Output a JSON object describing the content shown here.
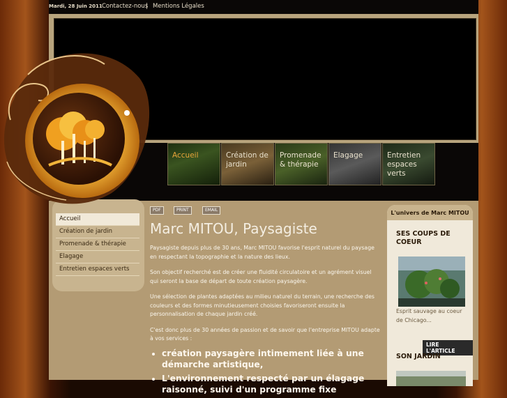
{
  "topbar": {
    "date": "Mardi, 28 Juin 2011",
    "contact": "Contactez-nous",
    "separator": "|",
    "legal": "Mentions Légales"
  },
  "nav": {
    "tabs": [
      {
        "label": "Accueil",
        "active": true
      },
      {
        "label": "Création de jardin",
        "active": false
      },
      {
        "label": "Promenade & thérapie",
        "active": false
      },
      {
        "label": "Elagage",
        "active": false
      },
      {
        "label": "Entretien espaces verts",
        "active": false
      }
    ]
  },
  "left_menu": {
    "items": [
      {
        "label": "Accueil",
        "active": true
      },
      {
        "label": "Création de jardin",
        "active": false
      },
      {
        "label": "Promenade & thérapie",
        "active": false
      },
      {
        "label": "Elagage",
        "active": false
      },
      {
        "label": "Entretien espaces verts",
        "active": false
      }
    ]
  },
  "tools": {
    "pdf": "PDF",
    "print": "PRINT",
    "email": "EMAIL"
  },
  "article": {
    "title": "Marc MITOU, Paysagiste",
    "paragraphs": [
      "Paysagiste depuis plus de 30 ans, Marc MITOU favorise l'esprit naturel du paysage en respectant la topographie et la nature des lieux.",
      "Son objectif recherché est de créer une fluidité circulatoire et un agrément visuel qui seront la base de départ de toute création paysagère.",
      "Une sélection de plantes adaptées au milieu naturel du terrain, une recherche des couleurs et des formes minutieusement choisies favoriseront ensuite la personnalisation de chaque jardin créé.",
      "C'est donc plus de 30 années de passion et de savoir que l'entreprise MITOU adapte à vos services :"
    ],
    "bullets": [
      "création paysagère intimement liée à une démarche artistique,",
      "L'environnement respecté par un élagage raisonné, suivi d'un programme fixe"
    ]
  },
  "right_sidebar": {
    "header": "L'univers de Marc MITOU",
    "section1_title": "SES COUPS DE COEUR",
    "caption": "Esprit sauvage au coeur de Chicago...",
    "read_more": "LIRE L'ARTICLE",
    "section2_title": "SON JARDIN"
  },
  "colors": {
    "accent": "#e8a43a",
    "frame": "#b8a47d",
    "content_bg": "#b39b74"
  }
}
